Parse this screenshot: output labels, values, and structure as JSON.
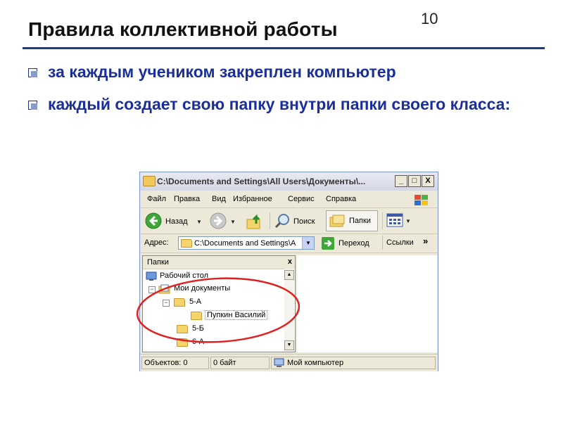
{
  "slide": {
    "number": "10",
    "title": "Правила коллективной работы",
    "bullets": [
      "за каждым учеником закреплен компьютер",
      "каждый создает свою папку внутри папки своего класса:"
    ]
  },
  "window": {
    "title": "C:\\Documents and Settings\\All Users\\Документы\\...",
    "controls": {
      "minimize": "_",
      "maximize": "□",
      "close": "X"
    },
    "menu": [
      "Файл",
      "Правка",
      "Вид",
      "Избранное",
      "Сервис",
      "Справка"
    ],
    "toolbar": {
      "back": "Назад",
      "search": "Поиск",
      "folders": "Папки"
    },
    "address": {
      "label": "Адрес:",
      "value": "C:\\Documents and Settings\\A",
      "go": "Переход",
      "links": "Ссылки",
      "more": "»"
    },
    "folders_pane": {
      "header": "Папки",
      "close": "x",
      "tree": [
        {
          "label": "Рабочий стол",
          "toggle": "",
          "icon": "desktop-icon"
        },
        {
          "label": "Мои документы",
          "toggle": "−",
          "icon": "my-documents-icon"
        },
        {
          "label": "5-А",
          "toggle": "−",
          "icon": "folder-icon"
        },
        {
          "label": "Пупкин Василий",
          "toggle": "",
          "icon": "folder-icon"
        },
        {
          "label": "5-Б",
          "toggle": "",
          "icon": "folder-icon"
        },
        {
          "label": "6-А",
          "toggle": "",
          "icon": "folder-icon"
        }
      ]
    },
    "status": {
      "objects": "Объектов: 0",
      "size": "0 байт",
      "location": "Мой компьютер"
    }
  },
  "colors": {
    "title_rule": "#1f3a8a",
    "bullet_text": "#1a2f9a",
    "ellipse": "#e02020"
  }
}
